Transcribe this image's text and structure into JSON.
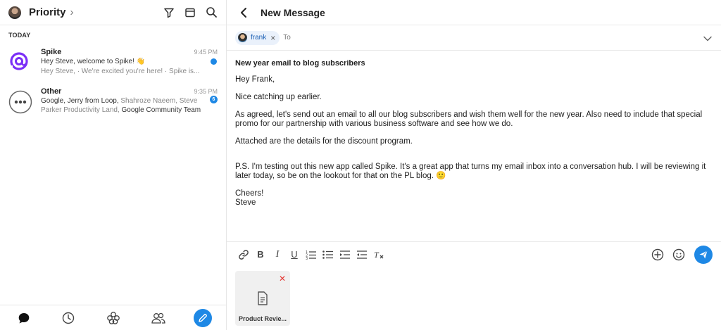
{
  "sidebar": {
    "title": "Priority",
    "section_label": "TODAY",
    "threads": [
      {
        "name": "Spike",
        "time": "9:45 PM",
        "line1": "Hey Steve, welcome to Spike! 👋",
        "line2": "Hey Steve, · We're excited you're here! · Spike is..."
      },
      {
        "name": "Other",
        "time": "9:35 PM",
        "badge": "6",
        "participants": [
          {
            "text": "Google, Jerry from Loop, ",
            "dim": false
          },
          {
            "text": "Shahroze Naeem, Steve Parker Productivity Land, ",
            "dim": true
          },
          {
            "text": "Google Community Team",
            "dim": false
          }
        ]
      }
    ]
  },
  "compose": {
    "title": "New Message",
    "recipient": "frank",
    "to_label": "To",
    "subject": "New year email to blog subscribers",
    "paragraphs": [
      "Hey Frank,",
      "Nice catching up earlier.",
      "As agreed, let's send out an email to all our blog subscribers and wish them well for the new year. Also need to include that special promo for our partnership with various business software and see how we do.",
      "Attached are the details for the discount program.",
      "P.S. I'm testing out this new app called Spike. It's a great app that turns my email inbox into a conversation hub. I will be reviewing it later today, so be on the lookout for that on the PL blog. 🙂"
    ],
    "closing": "Cheers!",
    "signature": "Steve",
    "attachment_name": "Product Revie..."
  },
  "colors": {
    "accent": "#1e88e5",
    "chip_bg": "#eaf1fb",
    "remove": "#e53935"
  }
}
